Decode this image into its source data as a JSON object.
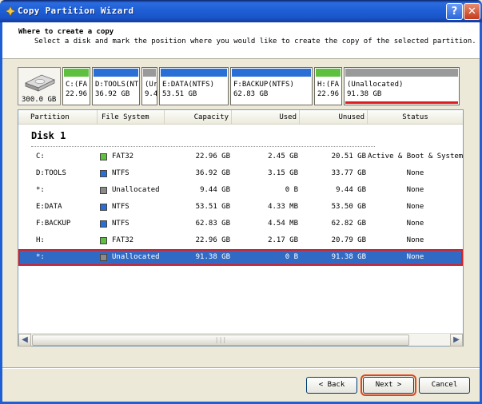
{
  "window": {
    "title": "Copy Partition Wizard",
    "help_glyph": "?",
    "close_glyph": "✕"
  },
  "header": {
    "title": "Where to create a copy",
    "subtitle": "Select a disk and mark the position where you would like to create the copy of the selected partition."
  },
  "disk_map": {
    "disk_size": "300.0 GB",
    "segments": [
      {
        "line1": "C:(FA",
        "line2": "22.96",
        "bar_color": "#5fbf3f"
      },
      {
        "line1": "D:TOOLS(NT",
        "line2": "36.92 GB",
        "bar_color": "#2a6fd6"
      },
      {
        "line1": "(Ur",
        "line2": "9.4",
        "bar_color": "#9a9a9a"
      },
      {
        "line1": "E:DATA(NTFS)",
        "line2": "53.51 GB",
        "bar_color": "#2a6fd6"
      },
      {
        "line1": "F:BACKUP(NTFS)",
        "line2": "62.83 GB",
        "bar_color": "#2a6fd6"
      },
      {
        "line1": "H:(FA",
        "line2": "22.96",
        "bar_color": "#5fbf3f"
      },
      {
        "line1": "(Unallocated)",
        "line2": "91.38 GB",
        "bar_color": "#9a9a9a"
      }
    ]
  },
  "table": {
    "columns": [
      "Partition",
      "File System",
      "Capacity",
      "Used",
      "Unused",
      "Status"
    ],
    "disk_label": "Disk 1",
    "rows": [
      {
        "partition": "C:",
        "fs": "FAT32",
        "fs_color": "#5fbf3f",
        "capacity": "22.96 GB",
        "used": "2.45 GB",
        "unused": "20.51 GB",
        "status": "Active & Boot & System"
      },
      {
        "partition": "D:TOOLS",
        "fs": "NTFS",
        "fs_color": "#2a6fd6",
        "capacity": "36.92 GB",
        "used": "3.15 GB",
        "unused": "33.77 GB",
        "status": "None"
      },
      {
        "partition": "*:",
        "fs": "Unallocated",
        "fs_color": "#8a8a8a",
        "capacity": "9.44 GB",
        "used": "0 B",
        "unused": "9.44 GB",
        "status": "None"
      },
      {
        "partition": "E:DATA",
        "fs": "NTFS",
        "fs_color": "#2a6fd6",
        "capacity": "53.51 GB",
        "used": "4.33 MB",
        "unused": "53.50 GB",
        "status": "None"
      },
      {
        "partition": "F:BACKUP",
        "fs": "NTFS",
        "fs_color": "#2a6fd6",
        "capacity": "62.83 GB",
        "used": "4.54 MB",
        "unused": "62.82 GB",
        "status": "None"
      },
      {
        "partition": "H:",
        "fs": "FAT32",
        "fs_color": "#5fbf3f",
        "capacity": "22.96 GB",
        "used": "2.17 GB",
        "unused": "20.79 GB",
        "status": "None"
      },
      {
        "partition": "*:",
        "fs": "Unallocated",
        "fs_color": "#8a8a8a",
        "capacity": "91.38 GB",
        "used": "0 B",
        "unused": "91.38 GB",
        "status": "None"
      }
    ],
    "selected_row": 6
  },
  "buttons": {
    "back": "< Back",
    "next": "Next >",
    "cancel": "Cancel"
  }
}
